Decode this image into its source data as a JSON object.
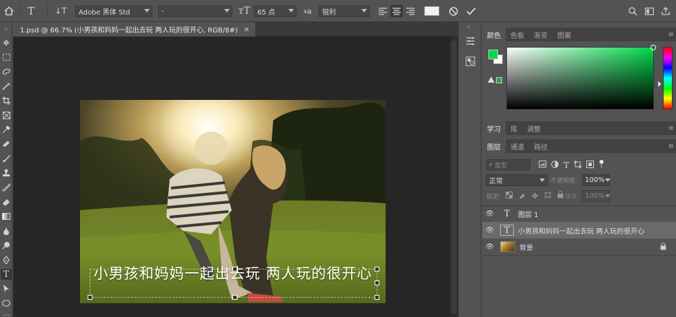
{
  "options_bar": {
    "font_family": "Adobe 黑体 Std",
    "font_style": "-",
    "font_size": "65 点",
    "aa_label": "a",
    "anti_alias": "锐利"
  },
  "document": {
    "tab_title": "1.psd @ 66.7% (小男孩和妈妈一起出去玩 两人玩的很开心, RGB/8#)",
    "close": "×",
    "overlay_text": "小男孩和妈妈一起出去玩 两人玩的很开心"
  },
  "color_panel": {
    "tabs": [
      "颜色",
      "色板",
      "渐变",
      "图案"
    ],
    "fg_color": "#00d94a",
    "bg_color": "#ffffff"
  },
  "learn_panel": {
    "tabs": [
      "学习",
      "库",
      "调整"
    ]
  },
  "layers_panel": {
    "tabs": [
      "图层",
      "通道",
      "路径"
    ],
    "filter_label": "类型",
    "blend_mode": "正常",
    "opacity_label": "不透明度:",
    "opacity_value": "100%",
    "lock_label": "锁定:",
    "fill_label": "填充:",
    "fill_value": "100%",
    "layers": [
      {
        "name": "图层 1",
        "type": "text"
      },
      {
        "name": "小男孩和妈妈一起出去玩 两人玩的很开心",
        "type": "text"
      },
      {
        "name": "背景",
        "type": "image"
      }
    ]
  },
  "colors": {
    "accent_green": "#00d94a",
    "panel_bg": "#535353",
    "canvas_bg": "#262626"
  }
}
